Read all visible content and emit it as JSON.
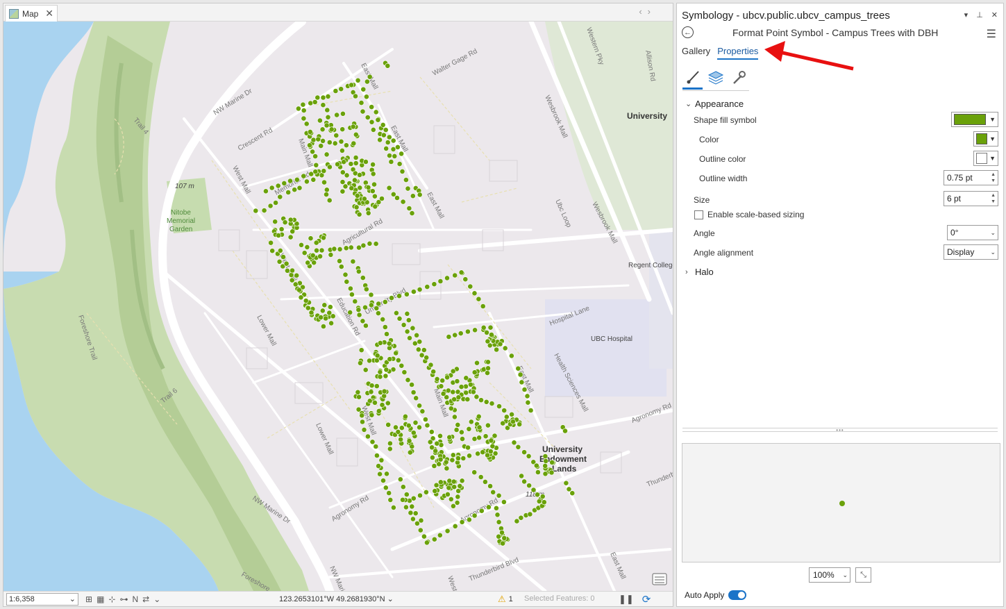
{
  "map_tab": {
    "label": "Map",
    "close": "✕"
  },
  "map_labels": {
    "nw_marine_dr_top": "NW Marine Dr",
    "walter_gage": "Walter Gage Rd",
    "east_mall_top": "East Mall",
    "western_pky": "Western Pky",
    "allison_rd": "Allison Rd",
    "university": "University",
    "crescent_rd": "Crescent Rd",
    "trail4": "Trail 4",
    "west_mall_top": "West Mall",
    "elevation_107": "107 m",
    "nitobe": "Nitobe",
    "memorial": "Memorial",
    "garden": "Garden",
    "main_mall": "Main Mall",
    "memorial_rd": "Memorial Rd",
    "east_mall_mid": "East Mall",
    "wesbrook_mall_top": "Wesbrook Mall",
    "ubc_loop": "Ubc Loop",
    "wesbrook_mall_mid": "Wesbrook Mall",
    "regent_college": "Regent College",
    "agricultural_rd": "Agricultural Rd",
    "west_mall_mid": "West Mall",
    "university_blvd": "University Blvd",
    "education_rd": "Education Rd",
    "lower_mall": "Lower Mall",
    "hospital_lane": "Hospital Lane",
    "ubc_hospital": "UBC Hospital",
    "foreshore_trail": "Foreshore Trail",
    "trail6": "Trail 6",
    "east_mall_low": "East Mall",
    "health_sciences_mall": "Health Sciences Mall",
    "agronomy_rd_right": "Agronomy Rd",
    "main_mall_low": "Main Mall",
    "west_mall_low": "West Mall",
    "lower_mall_low": "Lower Mall",
    "uel_1": "University",
    "uel_2": "Endowment",
    "uel_3": "Lands",
    "thunderbird_right": "Thunderbird",
    "elevation_118": "118 m",
    "agronomy_rd_left": "Agronomy Rd",
    "nw_marine_dr_low": "NW Marine Dr",
    "agronomy_rd_mid": "Agronomy Rd",
    "thunderbird_blvd": "Thunderbird Blvd",
    "east_mall_bottom": "East Mall",
    "west_bottom": "West",
    "nw_bottom": "NW Marine",
    "foreshore_bottom": "Foreshore"
  },
  "status_bar": {
    "scale": "1:6,358",
    "coordinates": "123.2653101°W 49.2681930°N",
    "warning_count": "1",
    "selected_features": "Selected Features: 0"
  },
  "symbology": {
    "title": "Symbology - ubcv.public.ubcv_campus_trees",
    "subtitle": "Format Point Symbol - Campus Trees with DBH",
    "tabs": [
      "Gallery",
      "Properties"
    ],
    "active_tab": "Properties",
    "sections": {
      "appearance": "Appearance",
      "halo": "Halo"
    },
    "fields": {
      "shape_fill": "Shape fill symbol",
      "color": "Color",
      "outline_color": "Outline color",
      "outline_width": "Outline width",
      "outline_width_value": "0.75 pt",
      "size": "Size",
      "size_value": "6 pt",
      "scale_sizing": "Enable scale-based sizing",
      "angle": "Angle",
      "angle_value": "0°",
      "angle_alignment": "Angle alignment",
      "angle_alignment_value": "Display"
    },
    "preview_zoom": "100%",
    "auto_apply": "Auto Apply"
  },
  "colors": {
    "symbol_fill": "#6aa10a",
    "outline": "#ffffff",
    "accent": "#1a73c8",
    "annotation_arrow": "#e81010"
  }
}
